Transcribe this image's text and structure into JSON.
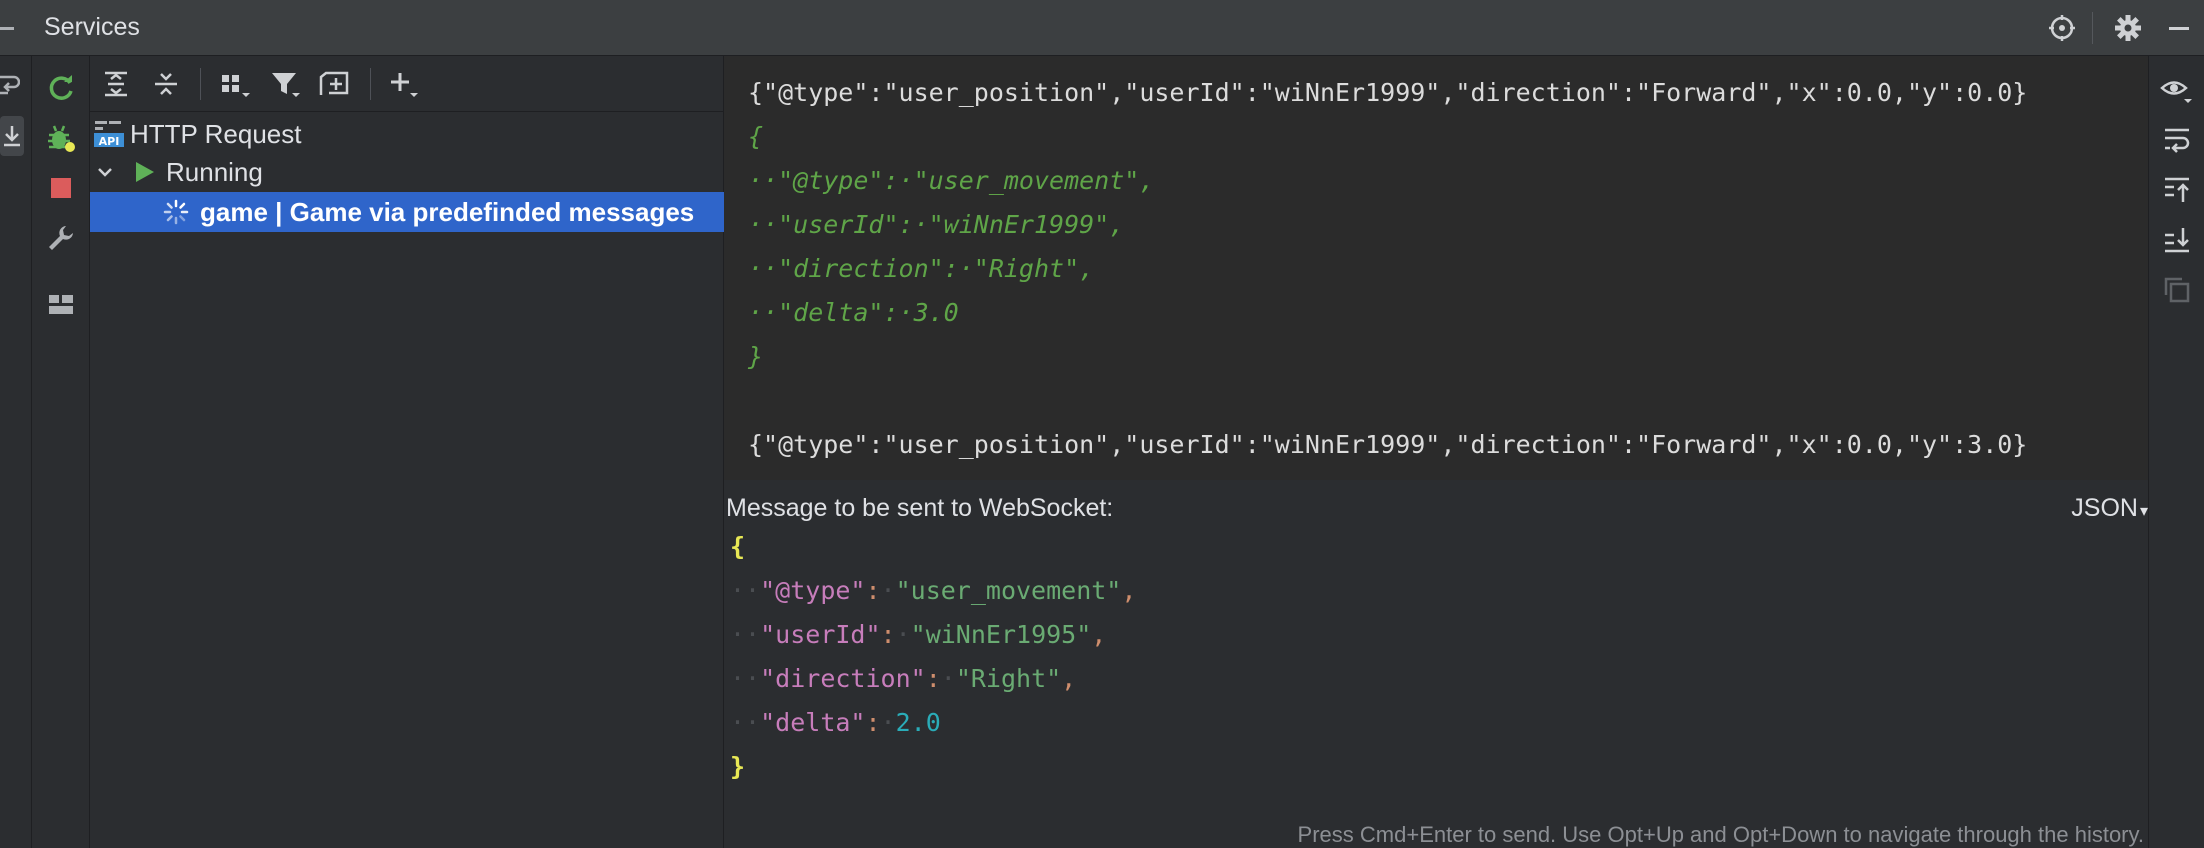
{
  "window": {
    "title": "Services"
  },
  "tree": {
    "root_label": "HTTP Request",
    "group_label": "Running",
    "selected_label": "game  |  Game via predefinded messages"
  },
  "output": {
    "line1": "{\"@type\":\"user_position\",\"userId\":\"wiNnEr1999\",\"direction\":\"Forward\",\"x\":0.0,\"y\":0.0}",
    "block": [
      "{",
      "··\"@type\":·\"user_movement\",",
      "··\"userId\":·\"wiNnEr1999\",",
      "··\"direction\":·\"Right\",",
      "··\"delta\":·3.0",
      "}"
    ],
    "line2": "{\"@type\":\"user_position\",\"userId\":\"wiNnEr1999\",\"direction\":\"Forward\",\"x\":0.0,\"y\":3.0}"
  },
  "input": {
    "header": "Message to be sent to WebSocket:",
    "format": "JSON",
    "message": {
      "open": "{",
      "close": "}",
      "fields": [
        {
          "key": "\"@type\"",
          "value": "\"user_movement\"",
          "kind": "string",
          "comma": ","
        },
        {
          "key": "\"userId\"",
          "value": "\"wiNnEr1995\"",
          "kind": "string",
          "comma": ","
        },
        {
          "key": "\"direction\"",
          "value": "\"Right\"",
          "kind": "string",
          "comma": ","
        },
        {
          "key": "\"delta\"",
          "value": "2.0",
          "kind": "number",
          "comma": ""
        }
      ]
    },
    "hint": "Press Cmd+Enter to send. Use Opt+Up and Opt+Down to navigate through the history."
  },
  "icons": {
    "target": "crosshair-icon",
    "settings": "gear-icon",
    "minimize": "minus-icon"
  },
  "colors": {
    "selection": "#2f65ca",
    "run_green": "#5fb158",
    "stop_red": "#db5c5c"
  }
}
